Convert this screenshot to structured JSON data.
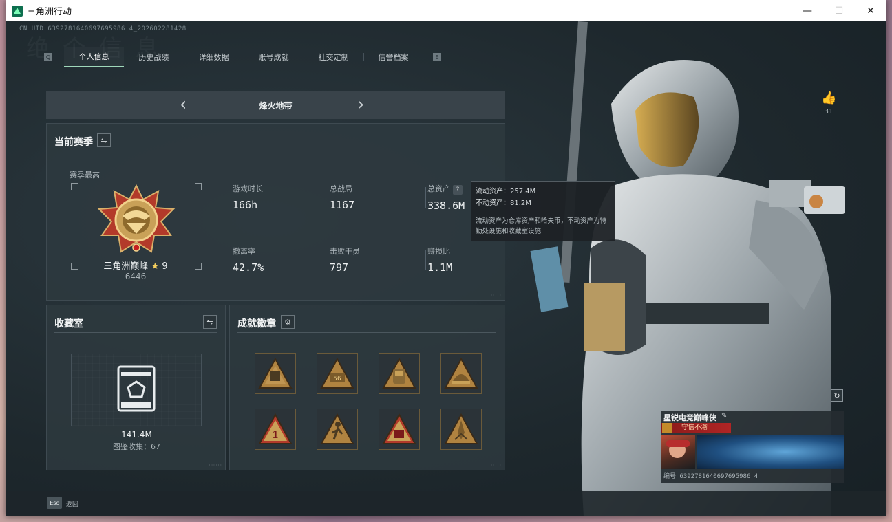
{
  "window": {
    "title": "三角洲行动"
  },
  "header": {
    "uid": "CN UID 6392781640697695986 4_202602281428",
    "watermark": "绝  个  信  息"
  },
  "tabs": [
    {
      "label": "个人信息",
      "active": true
    },
    {
      "label": "历史战绩",
      "active": false
    },
    {
      "label": "详细数据",
      "active": false
    },
    {
      "label": "账号成就",
      "active": false
    },
    {
      "label": "社交定制",
      "active": false
    },
    {
      "label": "信誉档案",
      "active": false
    }
  ],
  "tab_arrows": {
    "left": "Q",
    "right": "E"
  },
  "mode_selector": {
    "label": "烽火地带",
    "prev": "‹",
    "next": "›"
  },
  "season": {
    "title": "当前赛季",
    "peak_label": "赛季最高",
    "rank_name": "三角洲巅峰",
    "rank_star": "★",
    "rank_level": "9",
    "rank_score": "6446",
    "stats": [
      {
        "label": "游戏时长",
        "value": "166h"
      },
      {
        "label": "总战局",
        "value": "1167"
      },
      {
        "label": "总资产",
        "value": "338.6M",
        "help": "?"
      },
      {
        "label": "撤离率",
        "value": "42.7%"
      },
      {
        "label": "击败干员",
        "value": "797"
      },
      {
        "label": "赚损比",
        "value": "1.1M"
      }
    ]
  },
  "tooltip": {
    "liquid": "流动资产：257.4M",
    "fixed": "不动资产：81.2M",
    "desc": "流动资产为仓库资产和哈夫币，不动资产为特勤处设施和收藏室设施"
  },
  "collection": {
    "title": "收藏室",
    "value": "141.4M",
    "count": "图鉴收集：67"
  },
  "badges": {
    "title": "成就徽章",
    "items": [
      "infantry-badge",
      "56-badge",
      "vest-badge",
      "helmet-badge",
      "number-one-badge",
      "runner-badge",
      "crate-badge",
      "rocket-badge"
    ],
    "badge_56": "56",
    "badge_1": "1"
  },
  "hero": {
    "likes": "31"
  },
  "profile_card": {
    "title": "星锐电竞巅峰侠",
    "motto": "守信不渝",
    "id": "编号 6392781640697695986 4"
  },
  "footer": {
    "esc": "Esc",
    "back": "返回"
  },
  "colors": {
    "accent": "#9fd8ba",
    "gold": "#c9a158",
    "panel": "#2e393f"
  }
}
